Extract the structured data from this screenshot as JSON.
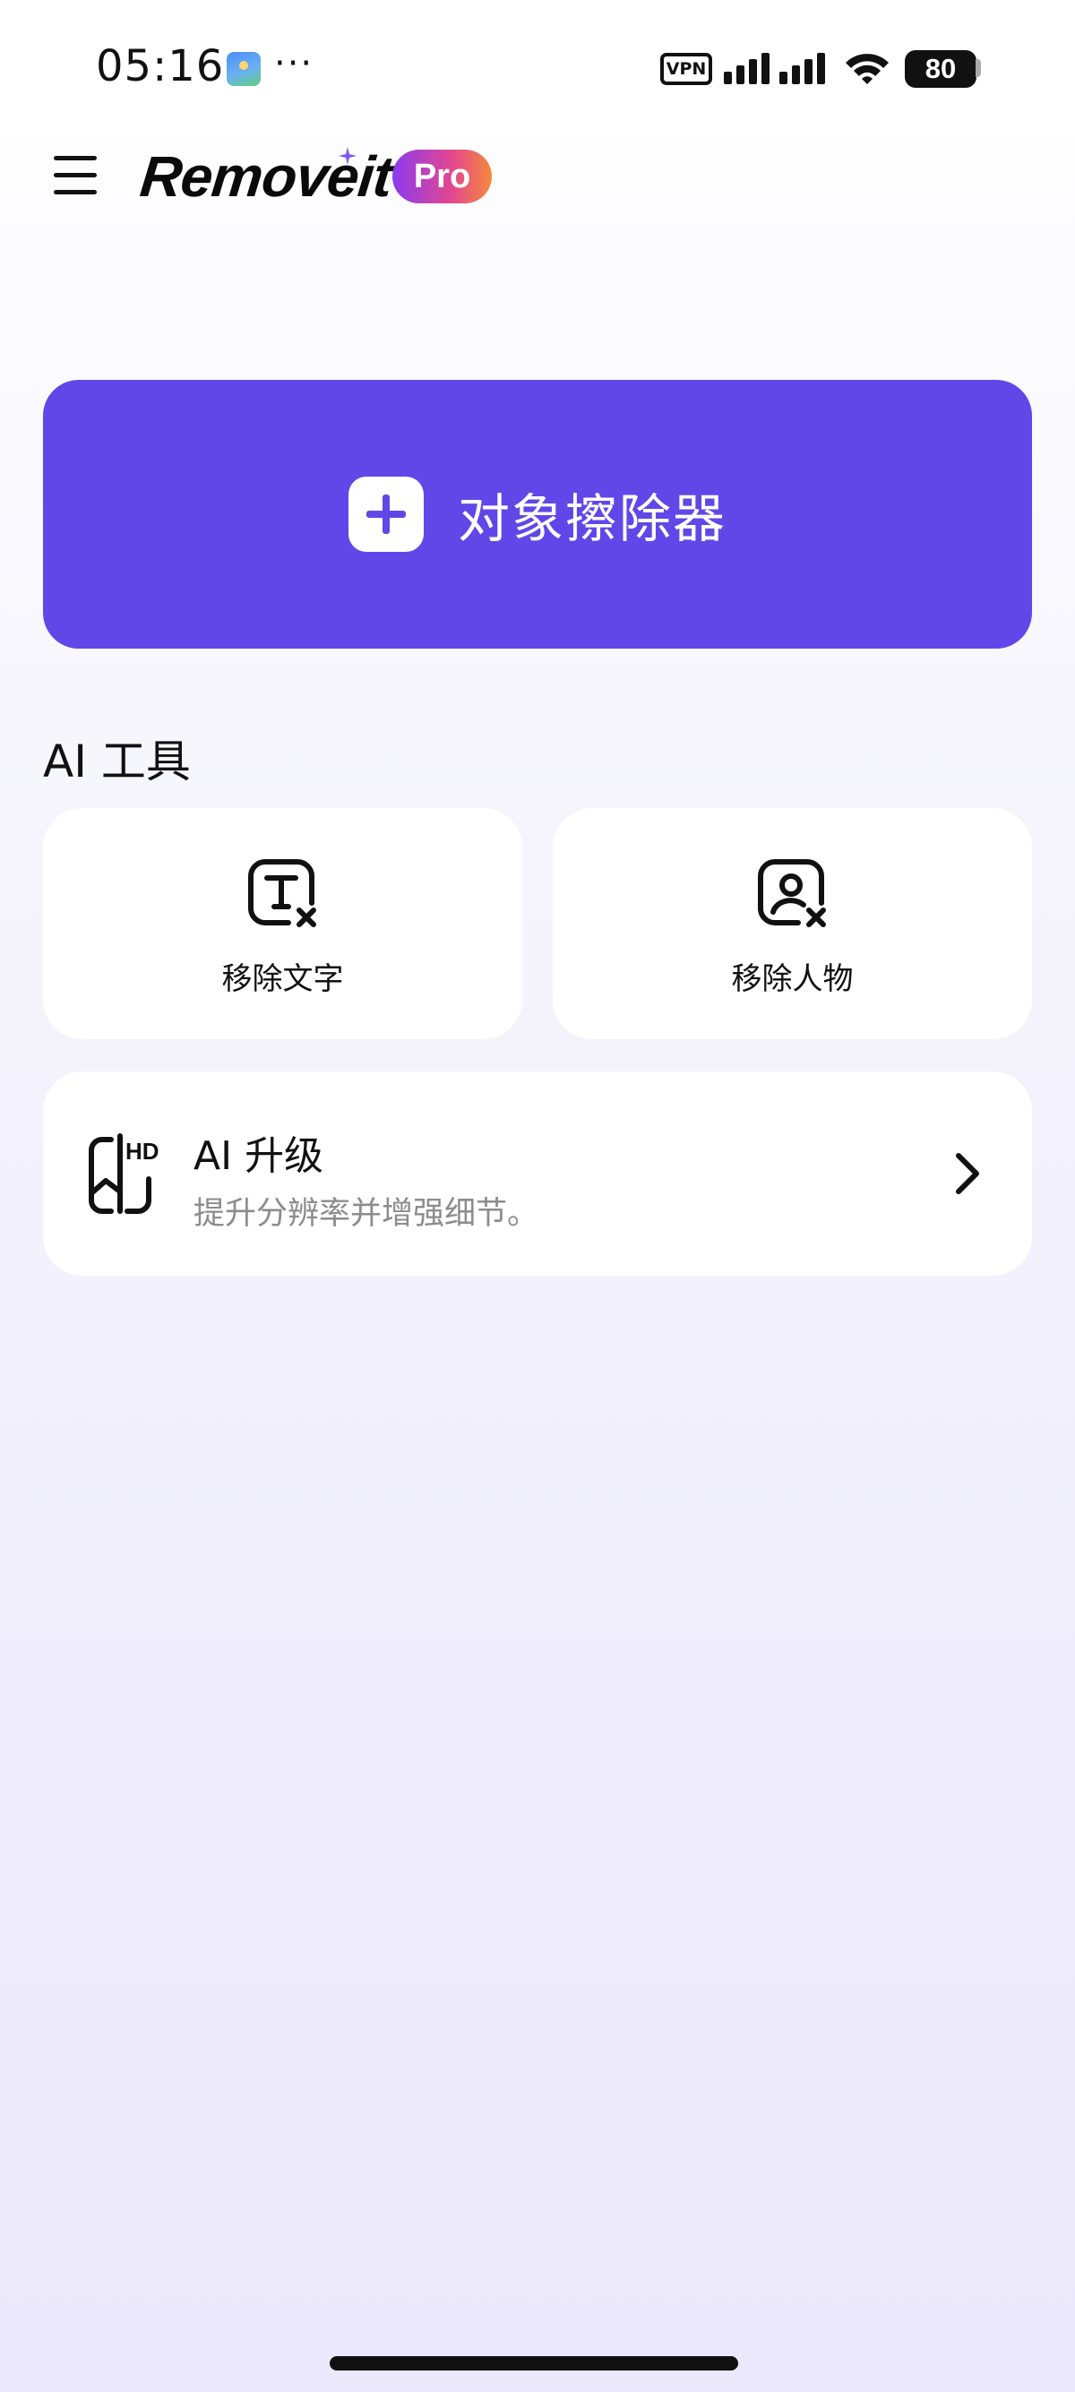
{
  "status_bar": {
    "time": "05:16",
    "more": "···",
    "vpn": "VPN",
    "battery": "80"
  },
  "header": {
    "logo": "Removeit",
    "pro_badge": "Pro"
  },
  "primary_action": {
    "label": "对象擦除器"
  },
  "ai_tools": {
    "section_title": "AI 工具",
    "tools": [
      {
        "label": "移除文字",
        "icon": "remove-text-icon"
      },
      {
        "label": "移除人物",
        "icon": "remove-person-icon"
      }
    ]
  },
  "upgrade": {
    "title": "AI 升级",
    "subtitle": "提升分辨率并增强细节。",
    "icon": "hd-upscale-icon"
  },
  "colors": {
    "primary": "#6147e8",
    "pro_gradient_start": "#8a3bf0",
    "pro_gradient_end": "#f58a3c"
  }
}
